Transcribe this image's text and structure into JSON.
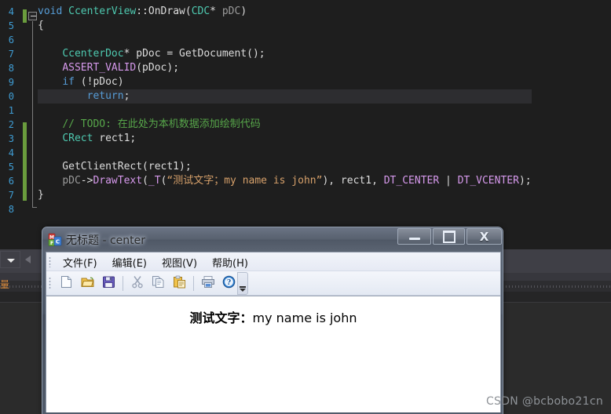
{
  "ide": {
    "theme_bg": "#1e1e1e",
    "gutter_color": "#3f9dd4",
    "line_numbers": [
      "4",
      "5",
      "6",
      "7",
      "8",
      "9",
      "0",
      "1",
      "2",
      "3",
      "4",
      "5",
      "6",
      "7",
      "8"
    ],
    "orange_text": "量",
    "code_lines": [
      {
        "indent": 0,
        "tokens": [
          {
            "t": "void ",
            "c": "t-kw"
          },
          {
            "t": "CcenterView",
            "c": "t-type"
          },
          {
            "t": "::OnDraw(",
            "c": "t-plain"
          },
          {
            "t": "CDC",
            "c": "t-type"
          },
          {
            "t": "* ",
            "c": "t-plain"
          },
          {
            "t": "pDC",
            "c": "t-param"
          },
          {
            "t": ")",
            "c": "t-plain"
          }
        ]
      },
      {
        "indent": 0,
        "tokens": [
          {
            "t": "{",
            "c": "t-plain"
          }
        ]
      },
      {
        "indent": 0,
        "tokens": [
          {
            "t": "",
            "c": "t-plain"
          }
        ]
      },
      {
        "indent": 0,
        "tokens": [
          {
            "t": "    ",
            "c": "t-plain"
          },
          {
            "t": "CcenterDoc",
            "c": "t-type"
          },
          {
            "t": "* pDoc = GetDocument();",
            "c": "t-plain"
          }
        ]
      },
      {
        "indent": 0,
        "tokens": [
          {
            "t": "    ",
            "c": "t-plain"
          },
          {
            "t": "ASSERT_VALID",
            "c": "t-macro"
          },
          {
            "t": "(pDoc);",
            "c": "t-plain"
          }
        ]
      },
      {
        "indent": 0,
        "tokens": [
          {
            "t": "    ",
            "c": "t-plain"
          },
          {
            "t": "if",
            "c": "t-kw"
          },
          {
            "t": " (!pDoc)",
            "c": "t-plain"
          }
        ]
      },
      {
        "indent": 0,
        "highlight": true,
        "tokens": [
          {
            "t": "        ",
            "c": "t-plain"
          },
          {
            "t": "return",
            "c": "t-kw"
          },
          {
            "t": ";",
            "c": "t-plain"
          }
        ]
      },
      {
        "indent": 0,
        "tokens": [
          {
            "t": "",
            "c": "t-plain"
          }
        ]
      },
      {
        "indent": 0,
        "tokens": [
          {
            "t": "    ",
            "c": "t-plain"
          },
          {
            "t": "// TODO: 在此处为本机数据添加绘制代码",
            "c": "t-comment"
          }
        ]
      },
      {
        "indent": 0,
        "tokens": [
          {
            "t": "    ",
            "c": "t-plain"
          },
          {
            "t": "CRect",
            "c": "t-type"
          },
          {
            "t": " rect1;",
            "c": "t-plain"
          }
        ]
      },
      {
        "indent": 0,
        "tokens": [
          {
            "t": "",
            "c": "t-plain"
          }
        ]
      },
      {
        "indent": 0,
        "tokens": [
          {
            "t": "    GetClientRect(rect1);",
            "c": "t-plain"
          }
        ]
      },
      {
        "indent": 0,
        "tokens": [
          {
            "t": "    ",
            "c": "t-plain"
          },
          {
            "t": "pDC",
            "c": "t-param"
          },
          {
            "t": "->",
            "c": "t-plain"
          },
          {
            "t": "DrawText",
            "c": "t-macro"
          },
          {
            "t": "(",
            "c": "t-plain"
          },
          {
            "t": "_T",
            "c": "t-macro"
          },
          {
            "t": "(",
            "c": "t-plain"
          },
          {
            "t": "“测试文字；my name is john”",
            "c": "t-str"
          },
          {
            "t": "), rect1, ",
            "c": "t-plain"
          },
          {
            "t": "DT_CENTER",
            "c": "t-macro"
          },
          {
            "t": " | ",
            "c": "t-plain"
          },
          {
            "t": "DT_VCENTER",
            "c": "t-macro"
          },
          {
            "t": ");",
            "c": "t-plain"
          }
        ]
      },
      {
        "indent": 0,
        "tokens": [
          {
            "t": "}",
            "c": "t-plain"
          }
        ]
      }
    ]
  },
  "app_window": {
    "icon_name": "mfc-app-icon",
    "title_doc": "无标题",
    "title_sep": " - ",
    "title_app": "center",
    "caption_buttons": [
      {
        "name": "minimize-button",
        "label": ""
      },
      {
        "name": "maximize-button",
        "label": ""
      },
      {
        "name": "close-button",
        "label": "X"
      }
    ],
    "menu": [
      {
        "name": "menu-file",
        "label": "文件(F)"
      },
      {
        "name": "menu-edit",
        "label": "编辑(E)"
      },
      {
        "name": "menu-view",
        "label": "视图(V)"
      },
      {
        "name": "menu-help",
        "label": "帮助(H)"
      }
    ],
    "toolbar": [
      {
        "name": "new-icon",
        "title": "新建"
      },
      {
        "name": "open-icon",
        "title": "打开"
      },
      {
        "name": "save-icon",
        "title": "保存"
      },
      {
        "sep": true
      },
      {
        "name": "cut-icon",
        "title": "剪切"
      },
      {
        "name": "copy-icon",
        "title": "复制"
      },
      {
        "name": "paste-icon",
        "title": "粘贴"
      },
      {
        "sep": true
      },
      {
        "name": "print-icon",
        "title": "打印"
      },
      {
        "name": "about-icon",
        "title": "关于"
      }
    ],
    "client_text_cjk": "测试文字：",
    "client_text_latin": "my name is john"
  },
  "watermark": {
    "text": "CSDN @bcbobo21cn"
  }
}
